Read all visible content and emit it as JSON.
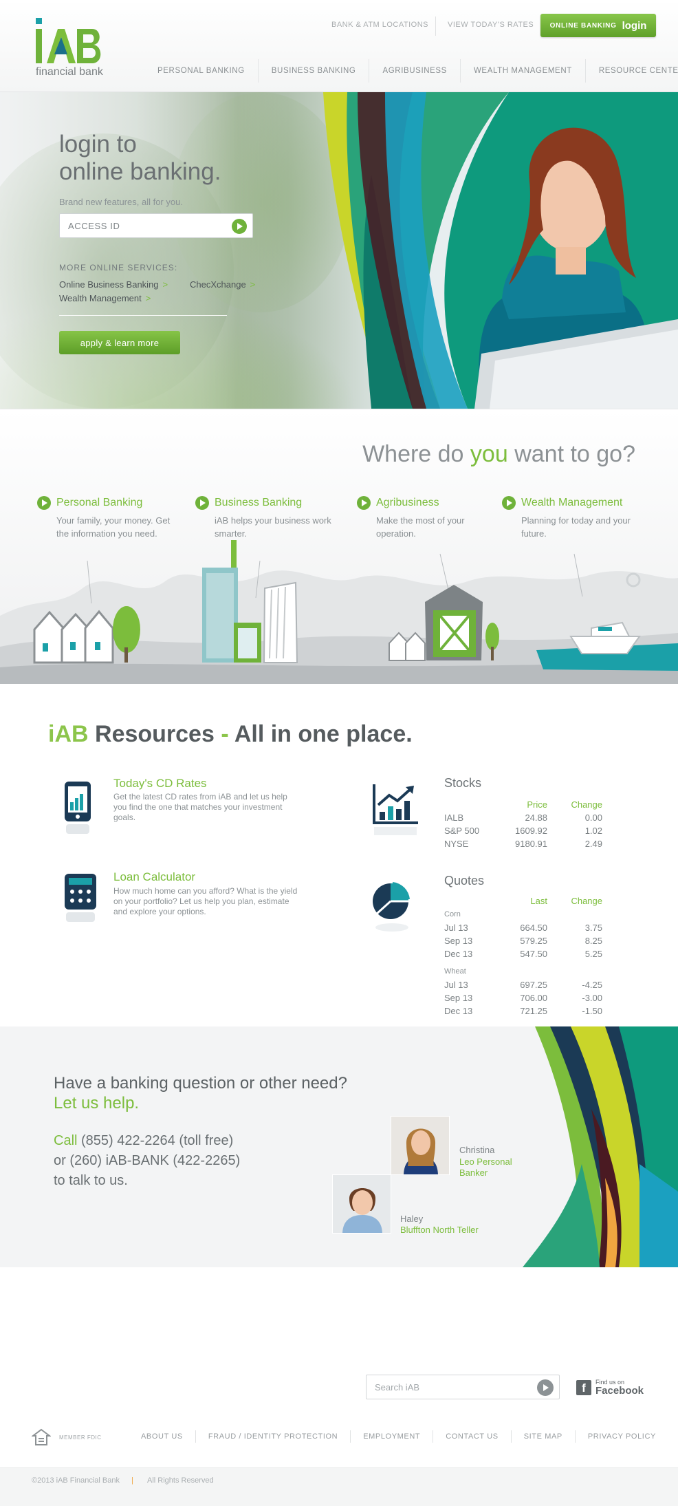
{
  "brand": {
    "logo_text": "iAB",
    "tagline": "financial bank",
    "colors": {
      "green": "#7cbd3c",
      "teal": "#1ba0a8",
      "navy": "#1b3a55",
      "grey": "#8c9194"
    }
  },
  "header": {
    "utility_links": [
      "BANK & ATM LOCATIONS",
      "VIEW TODAY'S RATES"
    ],
    "login_button": {
      "small": "ONLINE BANKING",
      "big": "login"
    },
    "nav": [
      "PERSONAL BANKING",
      "BUSINESS BANKING",
      "AGRIBUSINESS",
      "WEALTH MANAGEMENT",
      "RESOURCE CENTER"
    ]
  },
  "hero": {
    "title_line1": "login to",
    "title_line2": "online banking.",
    "subtitle": "Brand new features, all for you.",
    "access_placeholder": "ACCESS ID",
    "more_label": "MORE ONLINE SERVICES:",
    "more_links": [
      "Online Business Banking",
      "ChecXchange",
      "Wealth Management"
    ],
    "arrow": ">",
    "apply_button": "apply & learn more"
  },
  "where": {
    "title_a": "Where do ",
    "title_b": "you",
    "title_c": " want to go?",
    "destinations": [
      {
        "title": "Personal Banking",
        "desc": "Your family, your money. Get the information you need."
      },
      {
        "title": "Business Banking",
        "desc": "iAB helps your business work smarter."
      },
      {
        "title": "Agribusiness",
        "desc": "Make the most of your operation."
      },
      {
        "title": "Wealth Management",
        "desc": "Planning for today and your future."
      }
    ]
  },
  "resources": {
    "title_a": "iAB",
    "title_b": " Resources ",
    "title_c": "-",
    "title_d": " All in one place.",
    "cd": {
      "title": "Today's CD Rates",
      "text": "Get the latest CD rates from iAB and let us help you find the one that matches your investment goals.",
      "icon": "phone-chart-icon"
    },
    "loan": {
      "title": "Loan Calculator",
      "text": "How much home can you afford? What is the yield on your portfolio? Let us help you plan, estimate and explore your options.",
      "icon": "calculator-icon"
    },
    "stocks": {
      "title": "Stocks",
      "headers": [
        "",
        "Price",
        "Change"
      ],
      "rows": [
        [
          "IALB",
          "24.88",
          "0.00"
        ],
        [
          "S&P 500",
          "1609.92",
          "1.02"
        ],
        [
          "NYSE",
          "9180.91",
          "2.49"
        ]
      ]
    },
    "quotes": {
      "title": "Quotes",
      "headers": [
        "",
        "Last",
        "Change"
      ],
      "groups": [
        {
          "name": "Corn",
          "rows": [
            [
              "Jul 13",
              "664.50",
              "3.75"
            ],
            [
              "Sep 13",
              "579.25",
              "8.25"
            ],
            [
              "Dec 13",
              "547.50",
              "5.25"
            ]
          ]
        },
        {
          "name": "Wheat",
          "rows": [
            [
              "Jul 13",
              "697.25",
              "-4.25"
            ],
            [
              "Sep 13",
              "706.00",
              "-3.00"
            ],
            [
              "Dec 13",
              "721.25",
              "-1.50"
            ]
          ]
        }
      ]
    }
  },
  "help": {
    "question": "Have a banking question or other need?",
    "cta": "Let us help.",
    "call_word": "Call",
    "phone1": " (855) 422-2264 (toll free)",
    "phone2": "or (260) iAB-BANK (422-2265)",
    "phone3": "to talk to us.",
    "people": [
      {
        "name": "Christina",
        "role": "Leo Personal Banker"
      },
      {
        "name": "Haley",
        "role": "Bluffton North Teller"
      }
    ]
  },
  "footer": {
    "search_placeholder": "Search iAB",
    "facebook_small": "Find us on",
    "facebook_big": "Facebook",
    "member": "MEMBER FDIC",
    "links": [
      "ABOUT US",
      "FRAUD / IDENTITY PROTECTION",
      "EMPLOYMENT",
      "CONTACT US",
      "SITE MAP",
      "PRIVACY POLICY"
    ],
    "copyright": "©2013 iAB Financial Bank",
    "separator": "|",
    "rights": "All Rights Reserved"
  }
}
